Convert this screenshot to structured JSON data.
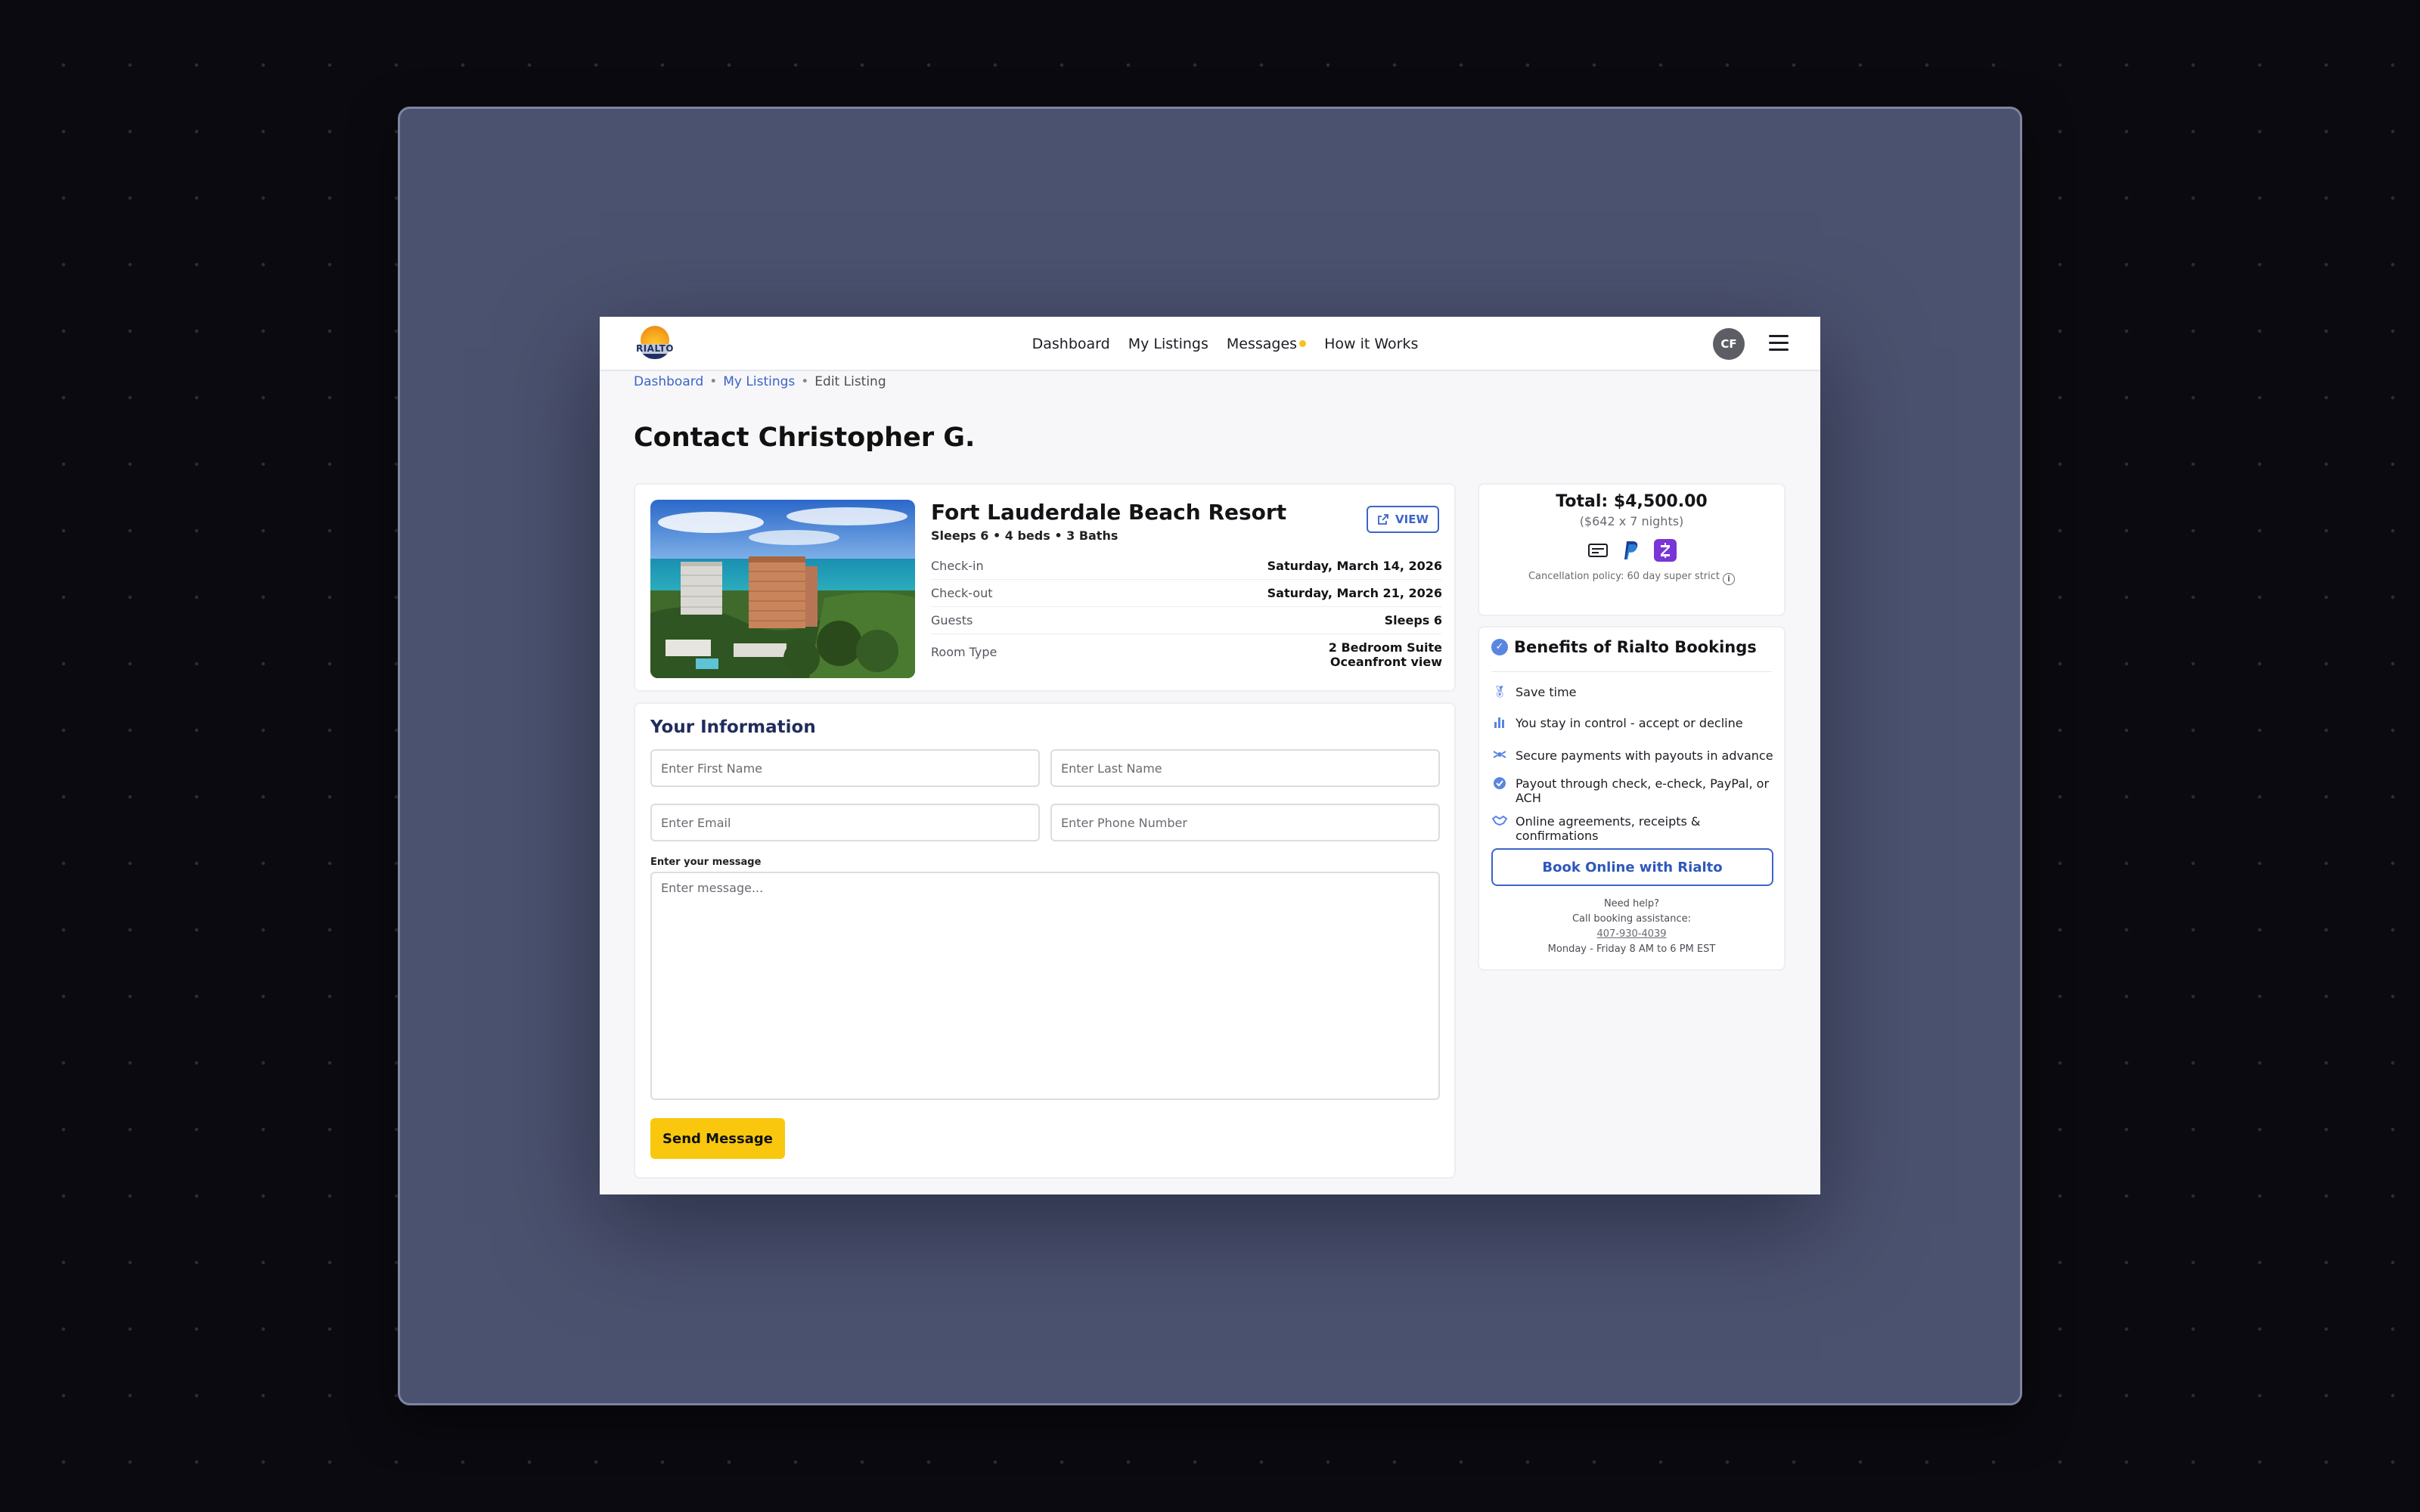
{
  "header": {
    "logo_text": "RIALTO",
    "nav": [
      {
        "label": "Dashboard"
      },
      {
        "label": "My Listings"
      },
      {
        "label": "Messages"
      },
      {
        "label": "How it Works"
      }
    ],
    "avatar_initials": "CF"
  },
  "breadcrumb": {
    "items": [
      {
        "label": "Dashboard"
      },
      {
        "label": "My Listings"
      },
      {
        "label": "Edit Listing"
      }
    ]
  },
  "page_title": "Contact Christopher G.",
  "listing": {
    "name": "Fort Lauderdale Beach Resort",
    "subtitle": "Sleeps 6 • 4 beds • 3 Baths",
    "view_label": "VIEW",
    "details": [
      {
        "key": "Check-in",
        "value": "Saturday, March 14, 2026"
      },
      {
        "key": "Check-out",
        "value": "Saturday, March 21, 2026"
      },
      {
        "key": "Guests",
        "value": "Sleeps 6"
      },
      {
        "key": "Room Type",
        "value": "2 Bedroom Suite",
        "value2": "Oceanfront view"
      }
    ]
  },
  "form": {
    "title": "Your Information",
    "first_name_placeholder": "Enter First Name",
    "last_name_placeholder": "Enter Last Name",
    "email_placeholder": "Enter Email",
    "phone_placeholder": "Enter Phone Number",
    "message_label": "Enter your message",
    "message_placeholder": "Enter message...",
    "send_label": "Send Message"
  },
  "pricing": {
    "total": "Total: $4,500.00",
    "breakdown": "($642 x 7 nights)",
    "payment_icons": [
      "check-icon",
      "paypal-icon",
      "zelle-icon"
    ],
    "cancellation": "Cancellation policy: 60 day super strict"
  },
  "benefits": {
    "title": "Benefits of Rialto Bookings",
    "items": [
      {
        "icon": "medal-icon",
        "label": "Save time"
      },
      {
        "icon": "bar-chart-icon",
        "label": "You stay in control - accept or decline"
      },
      {
        "icon": "secure-payment-icon",
        "label": "Secure payments with payouts in advance"
      },
      {
        "icon": "check-circle-icon",
        "label": "Payout through check, e-check, PayPal, or ACH"
      },
      {
        "icon": "handshake-icon",
        "label": "Online agreements, receipts & confirmations"
      }
    ],
    "book_label": "Book Online with Rialto",
    "help_line1": "Need help?",
    "help_line2": "Call booking assistance:",
    "phone": "407-930-4039",
    "hours": "Monday - Friday 8 AM to 6 PM EST"
  },
  "colors": {
    "accent_blue": "#3c65c8",
    "cta_yellow": "#f9c80e",
    "navy": "#1f2d5c"
  }
}
